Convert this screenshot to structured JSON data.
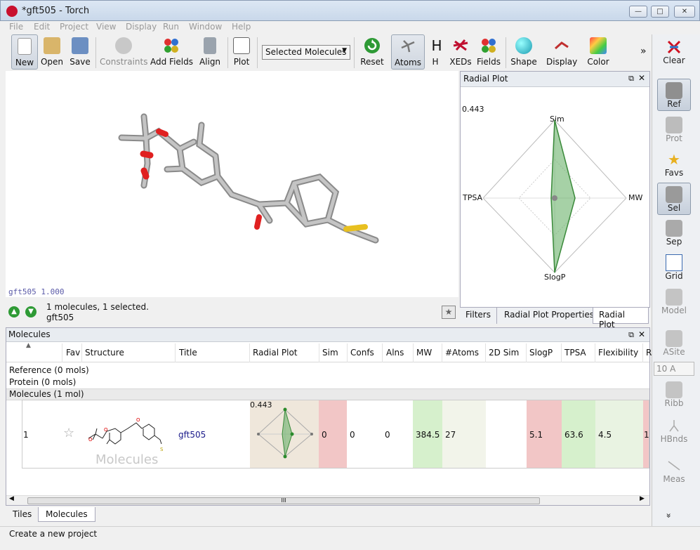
{
  "window": {
    "title": "*gft505 - Torch",
    "min": "—",
    "max": "□",
    "close": "✕"
  },
  "menu": [
    "File",
    "Edit",
    "Project",
    "View",
    "Display",
    "Run",
    "Window",
    "Help"
  ],
  "toolbar": {
    "new": "New",
    "open": "Open",
    "save": "Save",
    "constraints": "Constraints",
    "add_fields": "Add Fields",
    "align": "Align",
    "plot": "Plot",
    "selection": "Selected Molecules",
    "reset": "Reset",
    "atoms": "Atoms",
    "h": "H",
    "h_icon": "H",
    "xeds": "XEDs",
    "fields": "Fields",
    "shape": "Shape",
    "display": "Display",
    "color": "Color",
    "more": "»"
  },
  "right_toolbar": {
    "clear": "Clear",
    "ref": "Ref",
    "prot": "Prot",
    "favs": "Favs",
    "sel": "Sel",
    "sep": "Sep",
    "grid": "Grid",
    "model": "Model",
    "asite": "ASite",
    "distance": "10 A",
    "ribb": "Ribb",
    "hbnds": "HBnds",
    "meas": "Meas",
    "more": "»"
  },
  "viewer": {
    "caption": "gft505 1.000"
  },
  "status": {
    "line1": "1 molecules, 1 selected.",
    "line2": "gft505"
  },
  "radial": {
    "title": "Radial Plot",
    "max_label": "0.443",
    "axes": {
      "top": "Sim",
      "right": "MW",
      "bottom": "SlogP",
      "left": "TPSA"
    },
    "tabs": [
      "Filters",
      "Radial Plot Properties",
      "Radial Plot"
    ]
  },
  "molecules": {
    "title": "Molecules",
    "columns": [
      "Fav",
      "Structure",
      "Title",
      "Radial Plot",
      "Sim",
      "Confs",
      "Alns",
      "MW",
      "#Atoms",
      "2D Sim",
      "SlogP",
      "TPSA",
      "Flexibility",
      "R"
    ],
    "groups": [
      "Reference (0 mols)",
      "Protein (0 mols)",
      "Molecules (1 mol)"
    ],
    "row": {
      "index": "1",
      "fav": "☆",
      "title": "gft505",
      "radial_label": "0.443",
      "sim": "0",
      "confs": "0",
      "alns": "0",
      "mw": "384.5",
      "atoms": "27",
      "sim2d": "",
      "slogp": "5.1",
      "tpsa": "63.6",
      "flex": "4.5",
      "r": "1",
      "watermark": "Molecules"
    },
    "scroll_grip": "III"
  },
  "bottom_tabs": [
    "Tiles",
    "Molecules"
  ],
  "statusbar": "Create a new project",
  "colors": {
    "red_cell": "#f2c6c6",
    "green_cell": "#d6f0cc",
    "pale_green": "#e9f3e2",
    "radial_cell": "#efe7db"
  }
}
